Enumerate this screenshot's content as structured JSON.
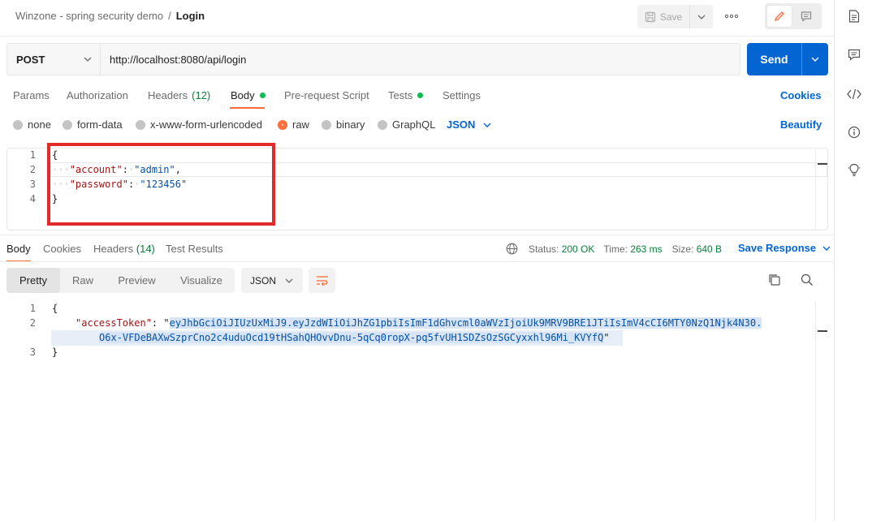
{
  "header": {
    "collection": "Winzone - spring security demo",
    "separator": "/",
    "request_name": "Login",
    "save_label": "Save",
    "more_icon": "ellipsis-icon"
  },
  "request": {
    "method": "POST",
    "url": "http://localhost:8080/api/login",
    "send_label": "Send"
  },
  "request_tabs": {
    "params": "Params",
    "authorization": "Authorization",
    "headers": "Headers",
    "headers_count": "(12)",
    "body": "Body",
    "pre_request": "Pre-request Script",
    "tests": "Tests",
    "settings": "Settings",
    "cookies": "Cookies"
  },
  "body_types": {
    "none": "none",
    "form_data": "form-data",
    "urlencoded": "x-www-form-urlencoded",
    "raw": "raw",
    "binary": "binary",
    "graphql": "GraphQL",
    "format": "JSON",
    "beautify": "Beautify"
  },
  "request_body": {
    "line_numbers": [
      "1",
      "2",
      "3",
      "4"
    ],
    "open_brace": "{",
    "account_key": "\"account\"",
    "account_value": "\"admin\"",
    "password_key": "\"password\"",
    "password_value": "\"123456\"",
    "close_brace": "}"
  },
  "response_tabs": {
    "body": "Body",
    "cookies": "Cookies",
    "headers": "Headers",
    "headers_count": "(14)",
    "test_results": "Test Results"
  },
  "response_status": {
    "status_label": "Status:",
    "status_value": "200 OK",
    "time_label": "Time:",
    "time_value": "263 ms",
    "size_label": "Size:",
    "size_value": "640 B",
    "save_response": "Save Response"
  },
  "response_view": {
    "pretty": "Pretty",
    "raw": "Raw",
    "preview": "Preview",
    "visualize": "Visualize",
    "format": "JSON"
  },
  "response_body": {
    "line_numbers": [
      "1",
      "2",
      "3"
    ],
    "open_brace": "{",
    "token_key": "\"accessToken\"",
    "token_line1": "eyJhbGciOiJIUzUxMiJ9.eyJzdWIiOiJhZG1pbiIsImF1dGhvcml0aWVzIjoiUk9MRV9BRE1JTiIsImV4cCI6MTY0NzQ1Njk4N30.",
    "token_line2": "O6x-VFDeBAXwSzprCno2c4uduOcd19tHSahQHOvvDnu-5qCq0ropX-pq5fvUH1SDZsOzSGCyxxhl96Mi_KVYfQ",
    "close_brace": "}"
  },
  "colors": {
    "accent": "#ff6c37",
    "primary": "#0265d2",
    "success": "#0a7d3b",
    "highlight_box": "#e22a2a"
  }
}
